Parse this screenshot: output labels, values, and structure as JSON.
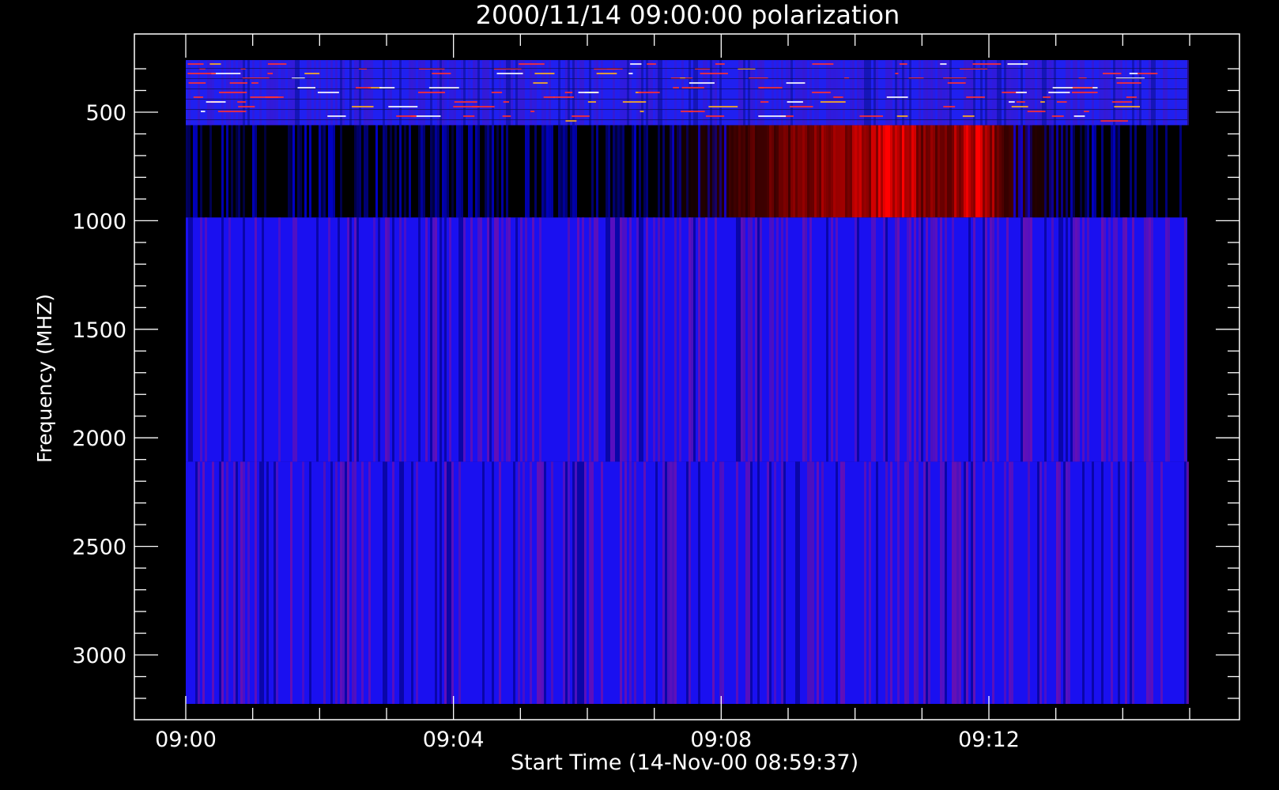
{
  "chart_data": {
    "type": "heatmap",
    "title": "2000/11/14 09:00:00 polarization",
    "xlabel": "Start Time (14-Nov-00 08:59:37)",
    "ylabel": "Frequency (MHZ)",
    "x_ticks": [
      "09:00",
      "09:04",
      "09:08",
      "09:12"
    ],
    "y_ticks": [
      "500",
      "1000",
      "1500",
      "2000",
      "2500",
      "3000"
    ],
    "x_range_minutes": [
      0,
      15
    ],
    "y_range_mhz": [
      260,
      3250
    ],
    "y_axis_reversed": true,
    "bands": [
      {
        "name": "band-1",
        "freq_mhz": [
          260,
          560
        ],
        "base_color": "#2020f0",
        "pattern": "noisy-with-red-streaks"
      },
      {
        "name": "band-2",
        "freq_mhz": [
          560,
          985
        ],
        "base_color": "#000010",
        "pattern": "black-to-red-burst",
        "peak_minutes": [
          10.6,
          11.8
        ]
      },
      {
        "name": "band-3",
        "freq_mhz": [
          985,
          2110
        ],
        "base_color": "#1a10f0",
        "pattern": "vertical-stripes"
      },
      {
        "name": "band-4",
        "freq_mhz": [
          2110,
          3250
        ],
        "base_color": "#1a10f0",
        "pattern": "vertical-stripes"
      }
    ],
    "colors": {
      "background": "#000000",
      "axes": "#ffffff",
      "low": "#0000ff",
      "high": "#ff0000"
    }
  }
}
